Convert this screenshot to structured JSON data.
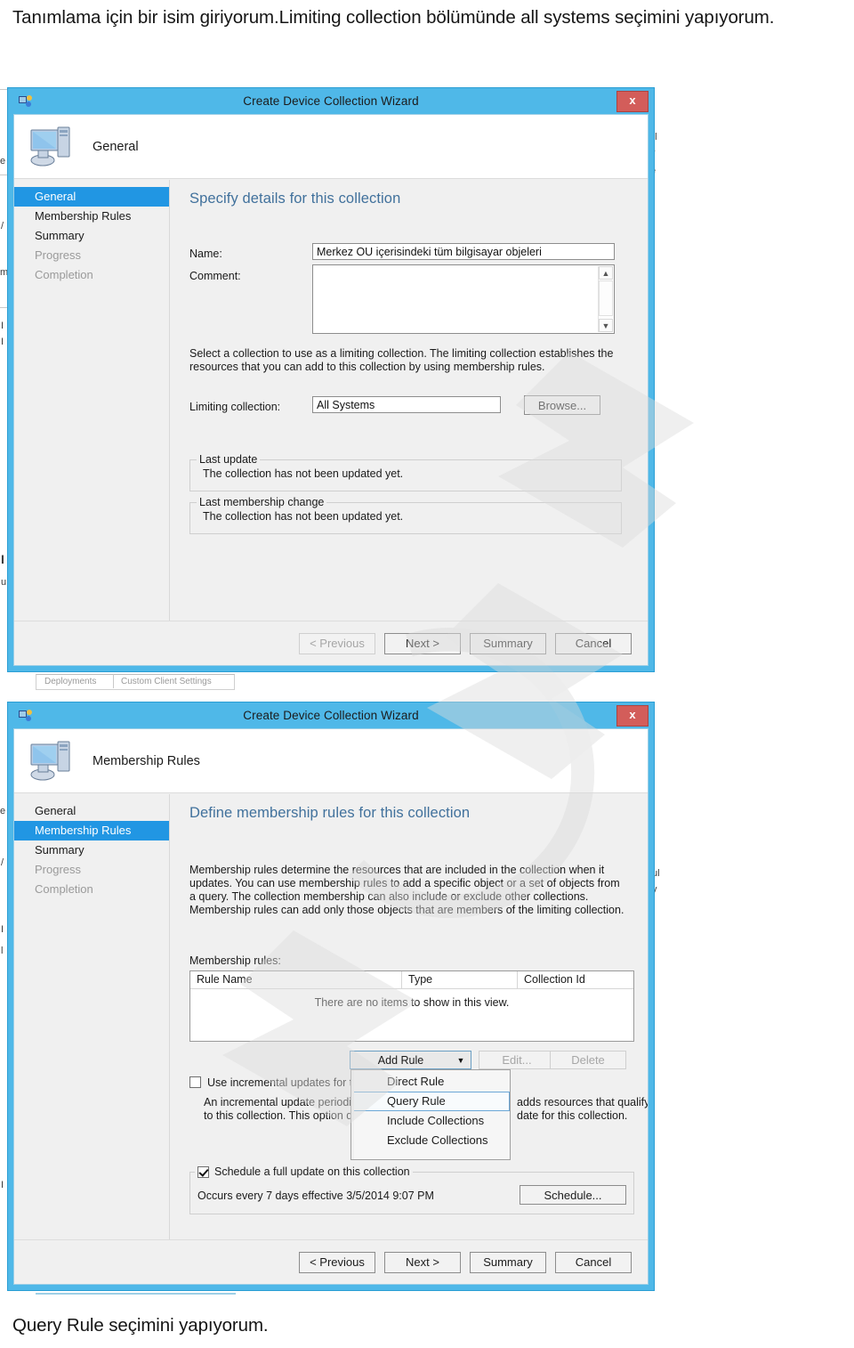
{
  "page": {
    "caption_top": "Tanımlama için bir isim giriyorum.Limiting collection bölümünde all systems seçimini yapıyorum.",
    "caption_bottom": "Query Rule seçimini yapıyorum.",
    "accent_title_color": "#4fb8e8",
    "close_button_color": "#d35d5a",
    "selection_color": "#2196e3",
    "heading_color": "#41719c"
  },
  "wizard_general": {
    "title": "Create Device Collection Wizard",
    "close_label": "x",
    "banner_title": "General",
    "nav_items": [
      {
        "label": "General",
        "state": "selected"
      },
      {
        "label": "Membership Rules",
        "state": "enabled"
      },
      {
        "label": "Summary",
        "state": "enabled"
      },
      {
        "label": "Progress",
        "state": "disabled"
      },
      {
        "label": "Completion",
        "state": "disabled"
      }
    ],
    "heading": "Specify details for this collection",
    "name_label": "Name:",
    "name_value": "Merkez OU içerisindeki tüm bilgisayar objeleri",
    "comment_label": "Comment:",
    "comment_value": "",
    "limiting_description": "Select a collection to use as a limiting collection. The limiting collection establishes the resources that you can add to this collection by using membership rules.",
    "limiting_label": "Limiting collection:",
    "limiting_value": "All Systems",
    "browse_label": "Browse...",
    "last_update_title": "Last update",
    "last_update_text": "The collection has not been updated yet.",
    "last_membership_title": "Last membership change",
    "last_membership_text": "The collection has not been updated yet.",
    "buttons": {
      "previous": "< Previous",
      "next": "Next >",
      "summary": "Summary",
      "cancel": "Cancel"
    }
  },
  "wizard_membership": {
    "title": "Create Device Collection Wizard",
    "close_label": "x",
    "banner_title": "Membership Rules",
    "nav_items": [
      {
        "label": "General",
        "state": "enabled"
      },
      {
        "label": "Membership Rules",
        "state": "selected"
      },
      {
        "label": "Summary",
        "state": "enabled"
      },
      {
        "label": "Progress",
        "state": "disabled"
      },
      {
        "label": "Completion",
        "state": "disabled"
      }
    ],
    "heading": "Define membership rules for this collection",
    "description": "Membership rules determine the resources that are included in the collection when it updates. You can use membership rules to add a specific object or a set of objects from a query. The collection membership can also include or exclude other collections. Membership rules can add only those objects that are members of the limiting collection.",
    "rules_label": "Membership rules:",
    "columns": [
      "Rule Name",
      "Type",
      "Collection Id"
    ],
    "empty_text": "There are no items to show in this view.",
    "add_rule_label": "Add Rule",
    "add_rule_arrow": "▼",
    "edit_label": "Edit...",
    "delete_label": "Delete",
    "menu_items": [
      {
        "label": "Direct Rule",
        "hovered": false
      },
      {
        "label": "Query Rule",
        "hovered": true
      },
      {
        "label": "Include Collections",
        "hovered": false
      },
      {
        "label": "Exclude Collections",
        "hovered": false
      }
    ],
    "incremental_checkbox_label": "Use incremental updates for this c",
    "incremental_checked": false,
    "incremental_text_line1": "An incremental update periodicall",
    "incremental_text_line2": "to this collection. This option doe",
    "incremental_text_right1": "adds resources that qualify",
    "incremental_text_right2": "date for this collection.",
    "schedule_checkbox_label": "Schedule a full update on this collection",
    "schedule_checked": true,
    "schedule_occurs_text": "Occurs every 7 days effective 3/5/2014 9:07 PM",
    "schedule_button": "Schedule...",
    "buttons": {
      "previous": "< Previous",
      "next": "Next >",
      "summary": "Summary",
      "cancel": "Cancel"
    }
  },
  "background": {
    "frag_a": "ul",
    "frag_b": "y",
    "frag_c": "e",
    "frag_d": "S",
    "frag_e": "e",
    "frag_f": "/",
    "frag_g": "m",
    "frag_h": "I",
    "frag_i": "u",
    "frag_j": "I",
    "frag_k": "l",
    "frag_l": "I",
    "frag_m": "ul",
    "frag_n": "y",
    "frag_o": "e",
    "frag_p": "S"
  }
}
